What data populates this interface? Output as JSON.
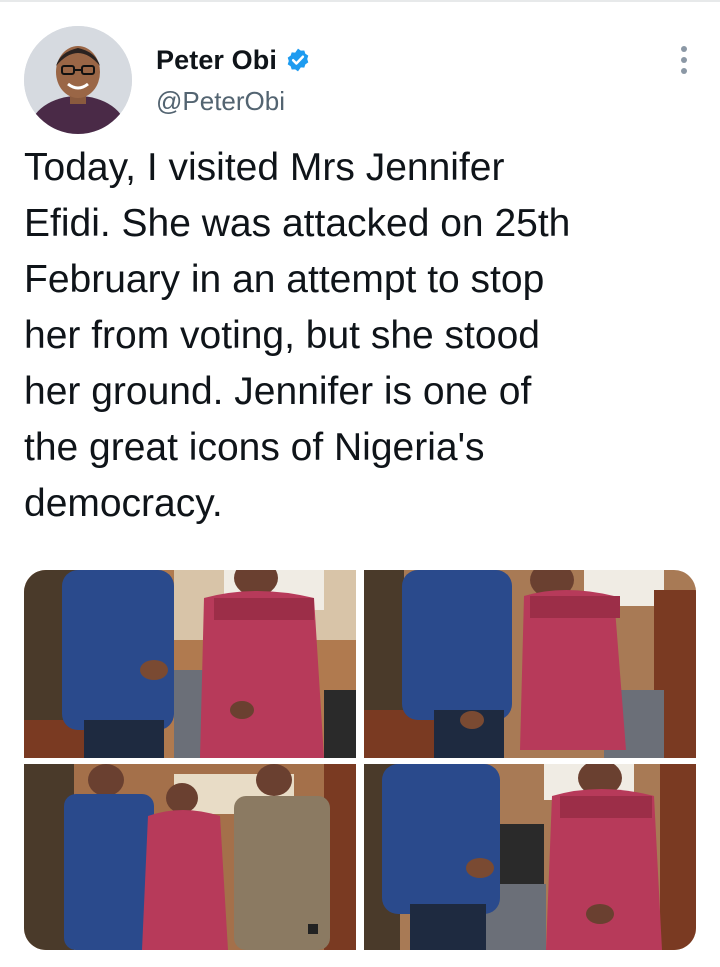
{
  "tweet": {
    "author": {
      "display_name": "Peter Obi",
      "handle": "@PeterObi",
      "verified": true
    },
    "text": "Today, I visited Mrs Jennifer\nEfidi. She was attacked on 25th\nFebruary in an attempt to stop\nher from voting, but she stood\nher ground. Jennifer is one of\nthe great icons of Nigeria's\ndemocracy.",
    "media": {
      "count": 4,
      "photos": [
        "photo-1",
        "photo-2",
        "photo-3",
        "photo-4"
      ]
    }
  },
  "icons": {
    "verified": "verified-badge-icon",
    "more": "more-options-icon"
  },
  "colors": {
    "verified_blue": "#1d9bf0",
    "text": "#0f1419",
    "secondary_text": "#536471",
    "shirt_blue": "#2a4a8c",
    "blouse_red": "#b73a5a"
  }
}
